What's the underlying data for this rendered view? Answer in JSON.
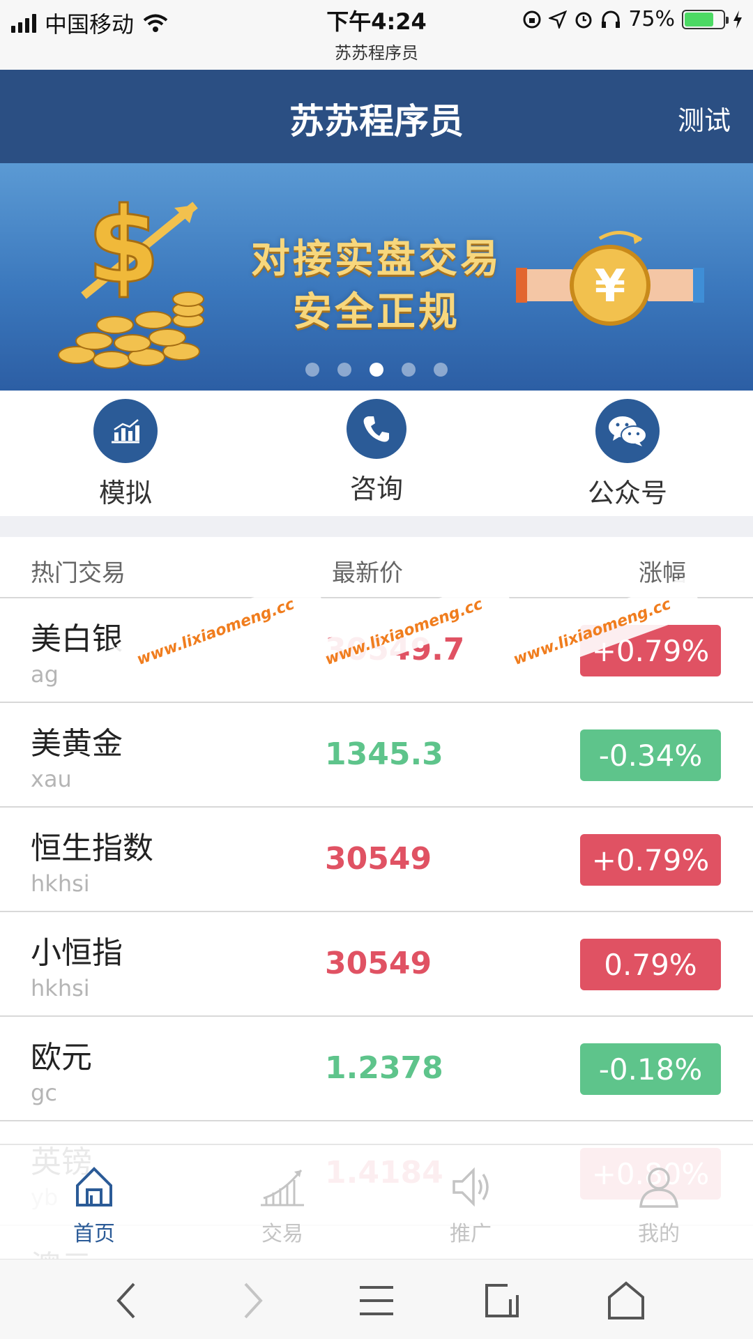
{
  "status_bar": {
    "carrier": "中国移动",
    "time": "下午4:24",
    "site": "苏苏程序员",
    "battery": "75%",
    "battery_level": 0.75
  },
  "header": {
    "title": "苏苏程序员",
    "action": "测试"
  },
  "banner": {
    "line1": "对接实盘交易",
    "line2": "安全正规",
    "slide_count": 5,
    "active_index": 2
  },
  "quick_actions": [
    {
      "label": "模拟",
      "icon": "chart-icon"
    },
    {
      "label": "咨询",
      "icon": "phone-icon"
    },
    {
      "label": "公众号",
      "icon": "wechat-icon"
    }
  ],
  "table": {
    "headers": {
      "name": "热门交易",
      "price": "最新价",
      "change": "涨幅"
    },
    "rows": [
      {
        "name": "美白银",
        "code": "ag",
        "price": "30549.7",
        "change": "+0.79%",
        "trend": "up"
      },
      {
        "name": "美黄金",
        "code": "xau",
        "price": "1345.3",
        "change": "-0.34%",
        "trend": "down"
      },
      {
        "name": "恒生指数",
        "code": "hkhsi",
        "price": "30549",
        "change": "+0.79%",
        "trend": "up"
      },
      {
        "name": "小恒指",
        "code": "hkhsi",
        "price": "30549",
        "change": "0.79%",
        "trend": "up"
      },
      {
        "name": "欧元",
        "code": "gc",
        "price": "1.2378",
        "change": "-0.18%",
        "trend": "down"
      },
      {
        "name": "英镑",
        "code": "yb",
        "price": "1.4184",
        "change": "+0.80%",
        "trend": "up"
      },
      {
        "name": "澳元",
        "code": "",
        "price": "",
        "change": "",
        "trend": "up"
      }
    ]
  },
  "watermark": "www.lixiaomeng.cc",
  "tabbar": [
    {
      "label": "首页",
      "icon": "home-icon",
      "active": true
    },
    {
      "label": "交易",
      "icon": "trade-chart-icon",
      "active": false
    },
    {
      "label": "推广",
      "icon": "speaker-icon",
      "active": false
    },
    {
      "label": "我的",
      "icon": "user-icon",
      "active": false
    }
  ],
  "colors": {
    "header": "#2b4f83",
    "accent": "#2b5b97",
    "up": "#e05263",
    "down": "#5ec48b"
  }
}
